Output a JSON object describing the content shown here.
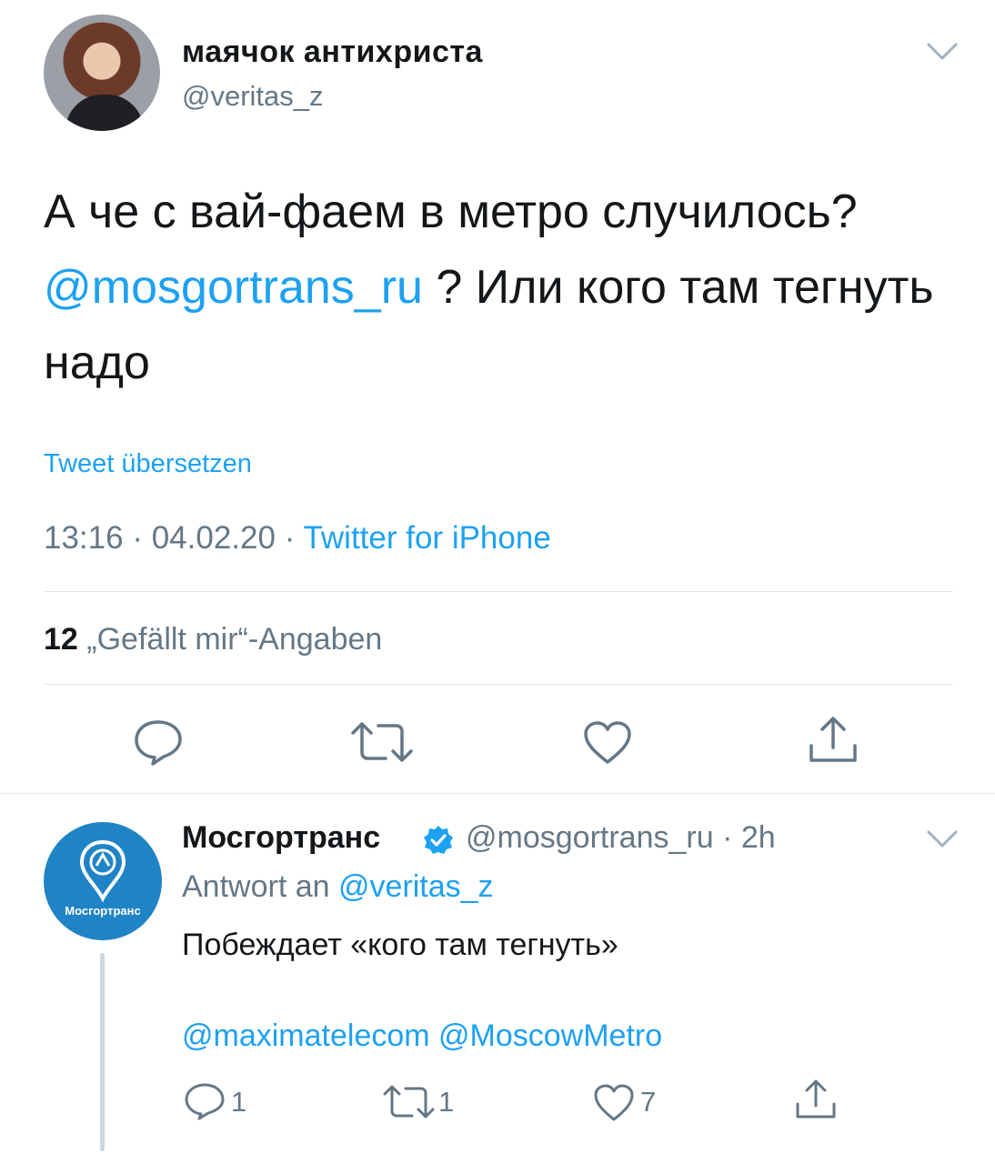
{
  "tweet": {
    "author_name": "маячок антихриста",
    "author_handle": "@veritas_z",
    "text_part1": "А че с вай-фаем в метро случилось?",
    "mention": "@mosgortrans_ru",
    "text_part2": " ? Или кого там тегнуть надо",
    "translate_label": "Tweet übersetzen",
    "time": "13:16",
    "date": "04.02.20",
    "source": "Twitter for iPhone",
    "likes_count": "12",
    "likes_label": "„Gefällt mir“-Angaben"
  },
  "reply": {
    "author_name": "Мосгортранс",
    "author_handle": "@mosgortrans_ru",
    "age": "2h",
    "replying_to_prefix": "Antwort an ",
    "replying_to_handle": "@veritas_z",
    "text": "Побеждает «кого там тегнуть»",
    "mentions": "@maximatelecom @MoscowMetro",
    "reply_count": "1",
    "retweet_count": "1",
    "like_count": "7",
    "avatar_logo_text": "Мосгортранс"
  },
  "colors": {
    "accent": "#1da1f2",
    "muted": "#657786",
    "text": "#14171a",
    "divider": "#e1e8ed",
    "verified": "#1da1f2",
    "mosgortrans_blue": "#1f84c6"
  },
  "icons": [
    "chevron-down-icon",
    "reply-icon",
    "retweet-icon",
    "like-icon",
    "share-icon",
    "verified-icon"
  ]
}
